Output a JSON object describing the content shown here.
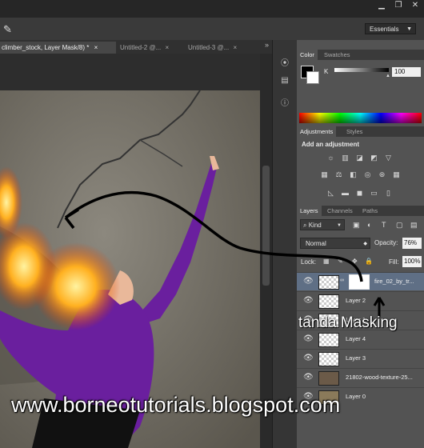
{
  "window": {
    "controls": [
      "minimize-icon",
      "restore-icon",
      "close-icon"
    ],
    "control_glyphs": [
      "▁",
      "❐",
      "✕"
    ]
  },
  "options_bar": {
    "tool_icon": "brush-icon",
    "tool_glyph": "✎",
    "workspace": "Essentials"
  },
  "document_tabs": [
    {
      "label": "climber_stock, Layer Mask/8) *",
      "close": "×",
      "active": true
    },
    {
      "label": "Untitled-2 @...",
      "close": "×",
      "active": false
    },
    {
      "label": "Untitled-3 @...",
      "close": "×",
      "active": false
    }
  ],
  "tab_more": "»",
  "color_panel": {
    "tabs": [
      "Color",
      "Swatches"
    ],
    "channel": "K",
    "value": "100",
    "slider_fraction": 1.0
  },
  "adjustments_panel": {
    "tabs": [
      "Adjustments",
      "Styles"
    ],
    "heading": "Add an adjustment",
    "icons": [
      "brightness-icon",
      "levels-icon",
      "curves-icon",
      "exposure-icon",
      "vibrance-icon",
      "hue-saturation-icon",
      "color-balance-icon",
      "black-white-icon",
      "photo-filter-icon",
      "channel-mixer-icon",
      "color-lookup-icon",
      "invert-icon",
      "posterize-icon",
      "threshold-icon",
      "selective-color-icon",
      "gradient-map-icon"
    ],
    "glyphs": [
      "☼",
      "▥",
      "◪",
      "◩",
      "▽",
      "▦",
      "⚖",
      "◧",
      "◎",
      "⊛",
      "▦",
      "◺",
      "▬",
      "◼",
      "▭",
      "▯"
    ]
  },
  "layers_panel": {
    "tabs": [
      "Layers",
      "Channels",
      "Paths"
    ],
    "kind_label": "Kind",
    "filter_icons": [
      "pixel-filter-icon",
      "adjustment-filter-icon",
      "type-filter-icon",
      "shape-filter-icon",
      "smart-filter-icon"
    ],
    "filter_glyphs": [
      "▣",
      "◐",
      "T",
      "▢",
      "▤"
    ],
    "blend_mode": "Normal",
    "opacity_label": "Opacity:",
    "opacity_value": "76%",
    "lock_label": "Lock:",
    "lock_icons": [
      "lock-transparent-icon",
      "lock-pixels-icon",
      "lock-position-icon",
      "lock-all-icon"
    ],
    "lock_glyphs": [
      "▦",
      "✎",
      "✥",
      "🔒"
    ],
    "fill_label": "Fill:",
    "fill_value": "100%",
    "layers": [
      {
        "name": "fire_02_by_tr...",
        "selected": true,
        "has_mask": true
      },
      {
        "name": "Layer 2",
        "selected": false
      },
      {
        "name": "Layer 1",
        "selected": false
      },
      {
        "name": "Layer 4",
        "selected": false
      },
      {
        "name": "Layer 3",
        "selected": false
      },
      {
        "name": "21802-wood-texture-25...",
        "selected": false
      },
      {
        "name": "Layer 0",
        "selected": false
      }
    ],
    "eye_glyph": "👁"
  },
  "annotations": {
    "caption": "tanda Masking",
    "watermark": "www.borneotutorials.blogspot.com"
  },
  "colors": {
    "accent_selected": "#5f6f85",
    "shirt": "#6a1f9e",
    "fire": "#ff9a1a"
  }
}
